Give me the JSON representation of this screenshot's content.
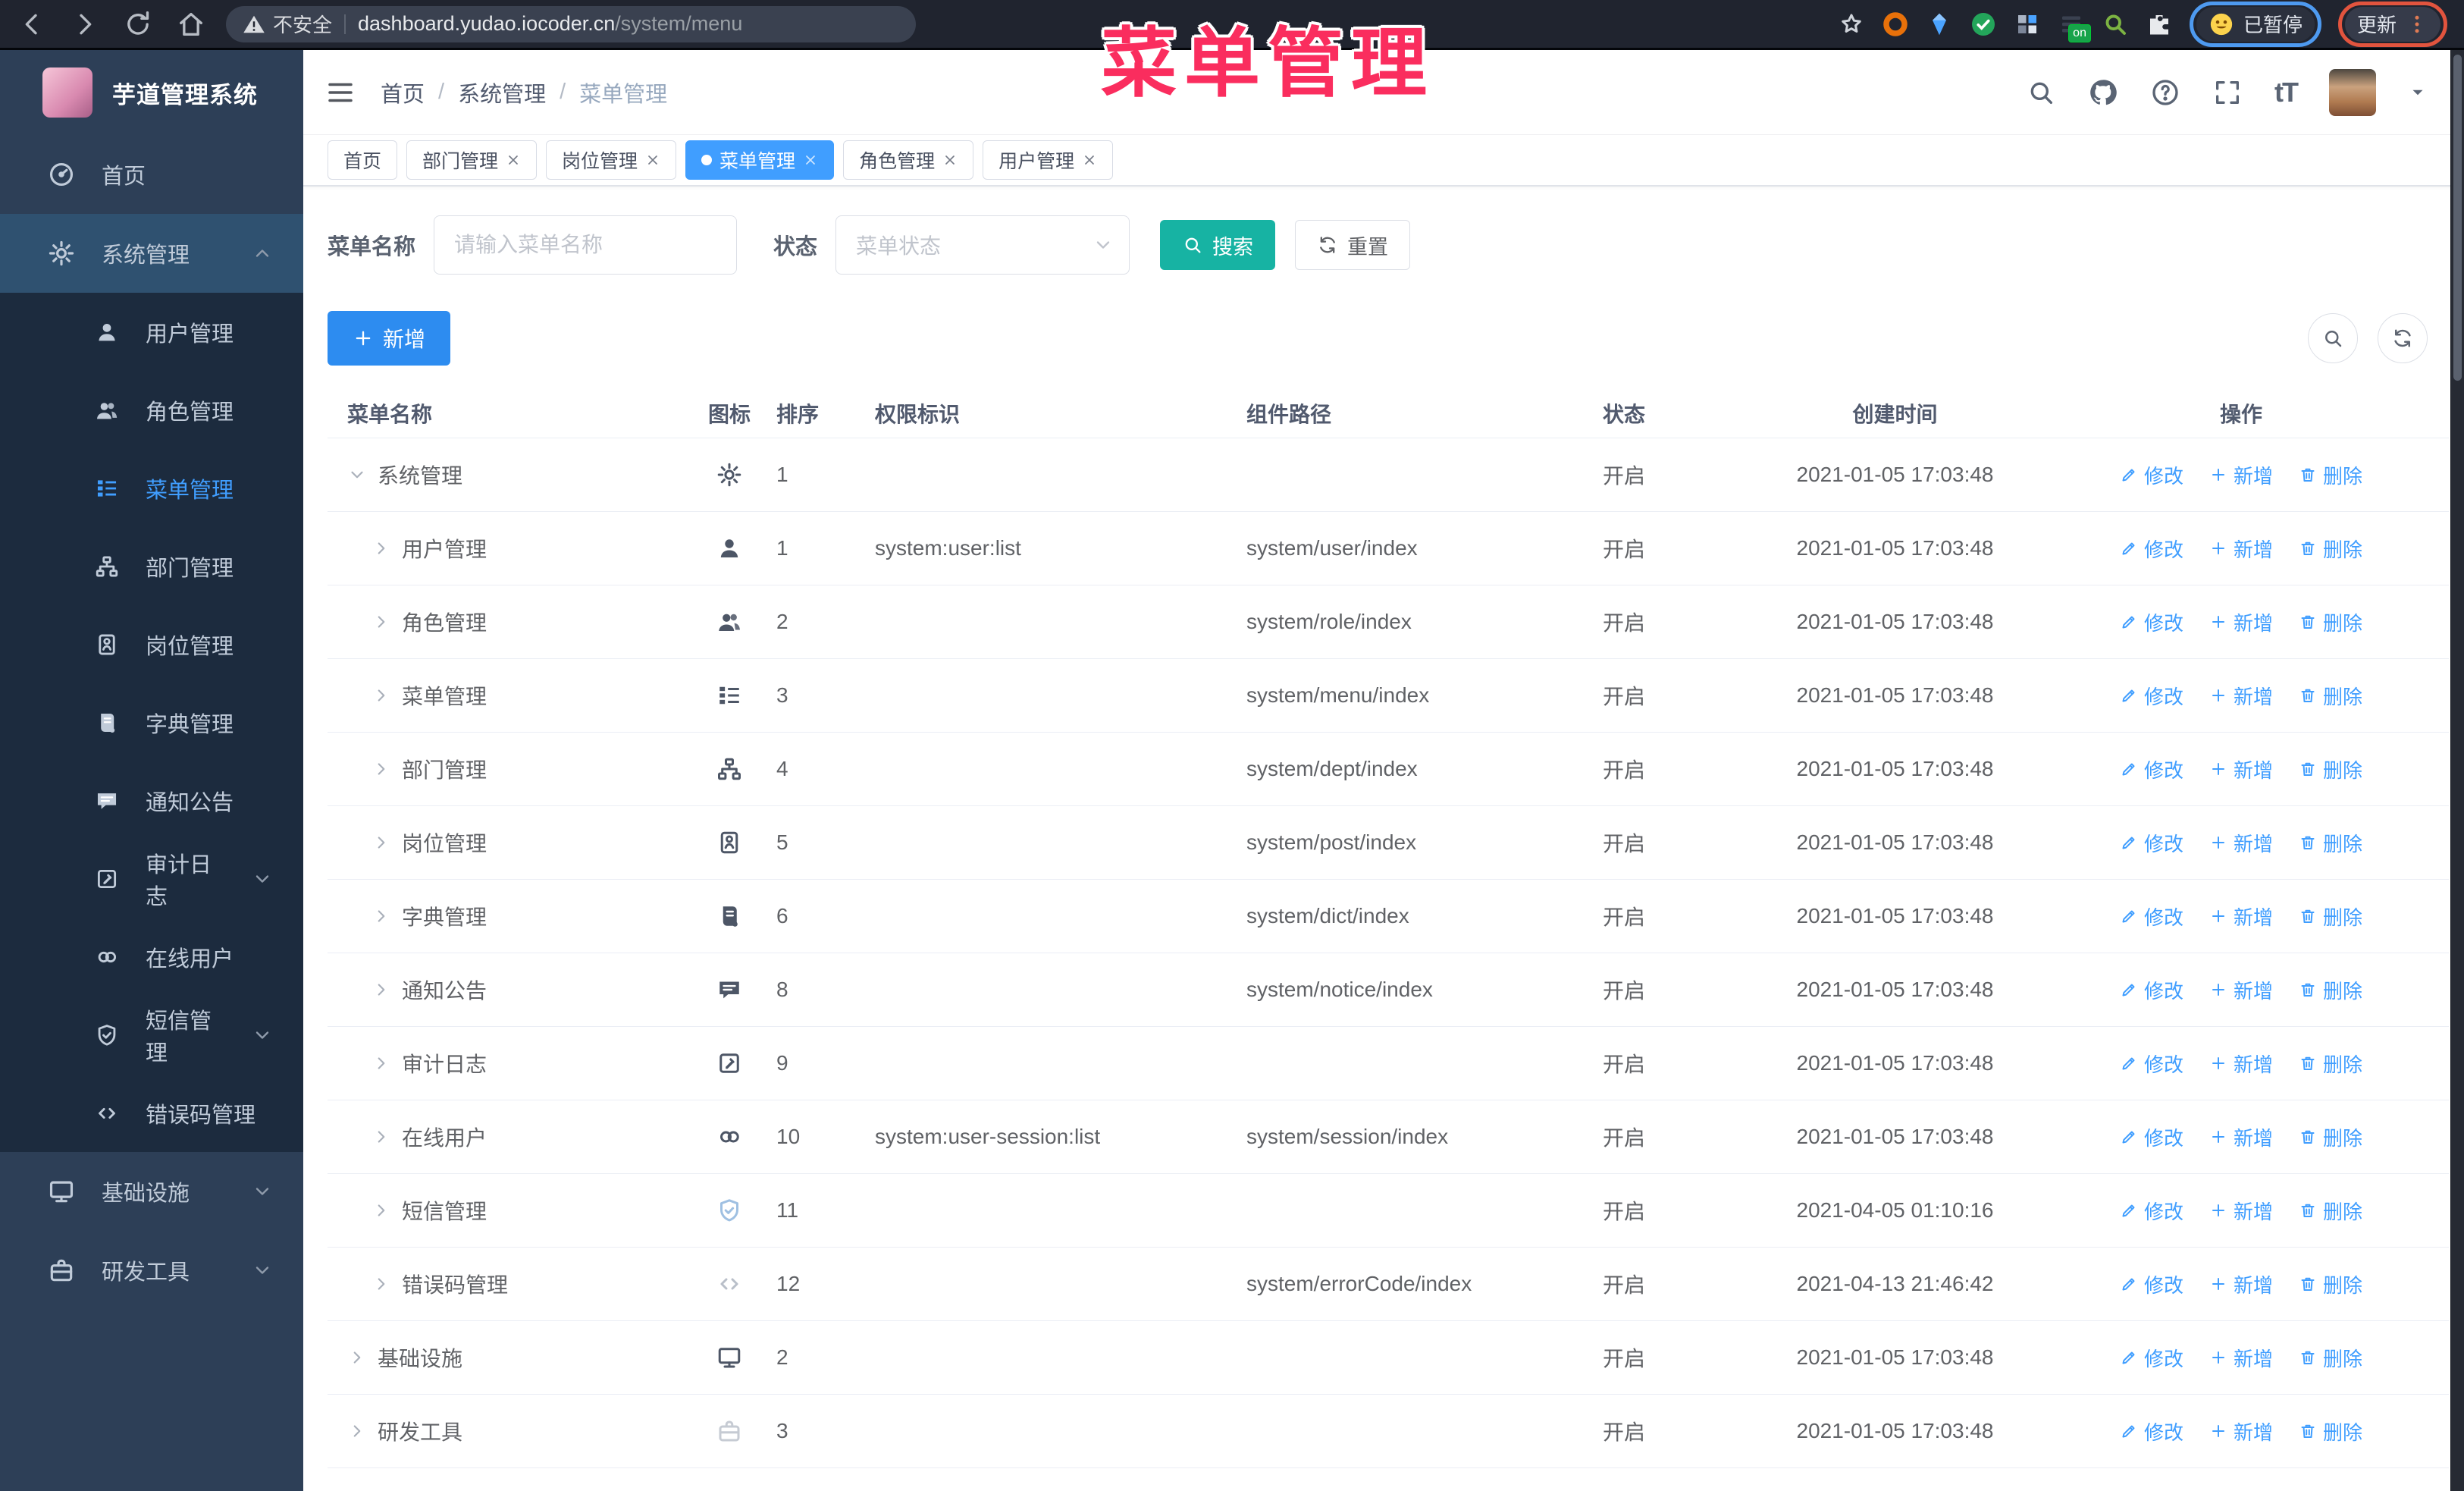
{
  "browser": {
    "nav": [
      "back-icon",
      "forward-icon",
      "reload-icon",
      "home-icon"
    ],
    "security_label": "不安全",
    "url_domain": "dashboard.yudao.iocoder.cn",
    "url_path": "/system/menu",
    "bookmark_icon": "star-icon",
    "extensions": [
      "ext-orange-icon",
      "ext-gem-icon",
      "ext-green-check-icon",
      "ext-grid-icon",
      "ext-on-icon",
      "ext-magnifier-icon",
      "ext-puzzle-icon"
    ],
    "extension_on_badge": "on",
    "paused_badge_label": "已暂停",
    "update_button_label": "更新"
  },
  "annotation": {
    "title": "菜单管理",
    "color": "#fa2d5e"
  },
  "sidebar": {
    "app_title": "芋道管理系统",
    "items": [
      {
        "label": "首页",
        "icon": "home-dash-icon",
        "level": 0
      },
      {
        "label": "系统管理",
        "icon": "gear-icon",
        "level": 0,
        "open": true,
        "chevron": "up"
      },
      {
        "label": "用户管理",
        "icon": "user-icon",
        "level": 1
      },
      {
        "label": "角色管理",
        "icon": "users-icon",
        "level": 1
      },
      {
        "label": "菜单管理",
        "icon": "menu-tree-icon",
        "level": 1,
        "active": true
      },
      {
        "label": "部门管理",
        "icon": "org-icon",
        "level": 1
      },
      {
        "label": "岗位管理",
        "icon": "badge-icon",
        "level": 1
      },
      {
        "label": "字典管理",
        "icon": "book-icon",
        "level": 1
      },
      {
        "label": "通知公告",
        "icon": "message-icon",
        "level": 1
      },
      {
        "label": "审计日志",
        "icon": "log-icon",
        "level": 1,
        "chevron": "down"
      },
      {
        "label": "在线用户",
        "icon": "online-icon",
        "level": 1
      },
      {
        "label": "短信管理",
        "icon": "shield-icon",
        "level": 1,
        "chevron": "down"
      },
      {
        "label": "错误码管理",
        "icon": "code-icon",
        "level": 1
      },
      {
        "label": "基础设施",
        "icon": "monitor-icon",
        "level": 0,
        "chevron": "down"
      },
      {
        "label": "研发工具",
        "icon": "briefcase-icon",
        "level": 0,
        "chevron": "down"
      }
    ]
  },
  "header": {
    "breadcrumb": [
      {
        "label": "首页"
      },
      {
        "label": "系统管理"
      },
      {
        "label": "菜单管理",
        "current": true
      }
    ],
    "icons": [
      "search-icon",
      "github-icon",
      "question-icon",
      "fullscreen-icon",
      "font-size-icon"
    ],
    "font_size_glyph": "tT"
  },
  "tabs": [
    {
      "label": "首页"
    },
    {
      "label": "部门管理",
      "closable": true
    },
    {
      "label": "岗位管理",
      "closable": true
    },
    {
      "label": "菜单管理",
      "closable": true,
      "active": true
    },
    {
      "label": "角色管理",
      "closable": true
    },
    {
      "label": "用户管理",
      "closable": true
    }
  ],
  "search": {
    "name_label": "菜单名称",
    "name_placeholder": "请输入菜单名称",
    "status_label": "状态",
    "status_placeholder": "菜单状态",
    "search_label": "搜索",
    "reset_label": "重置"
  },
  "toolbar": {
    "add_label": "新增"
  },
  "table": {
    "columns": [
      "菜单名称",
      "图标",
      "排序",
      "权限标识",
      "组件路径",
      "状态",
      "创建时间",
      "操作"
    ],
    "actions": {
      "edit": "修改",
      "add": "新增",
      "delete": "删除"
    },
    "rows": [
      {
        "name": "系统管理",
        "icon": "gear-icon",
        "level": 0,
        "caret": "down",
        "sort": "1",
        "perm": "",
        "path": "",
        "status": "开启",
        "time": "2021-01-05 17:03:48"
      },
      {
        "name": "用户管理",
        "icon": "user-icon",
        "level": 1,
        "caret": "right",
        "sort": "1",
        "perm": "system:user:list",
        "path": "system/user/index",
        "status": "开启",
        "time": "2021-01-05 17:03:48"
      },
      {
        "name": "角色管理",
        "icon": "users-icon",
        "level": 1,
        "caret": "right",
        "sort": "2",
        "perm": "",
        "path": "system/role/index",
        "status": "开启",
        "time": "2021-01-05 17:03:48"
      },
      {
        "name": "菜单管理",
        "icon": "menu-tree-icon",
        "level": 1,
        "caret": "right",
        "sort": "3",
        "perm": "",
        "path": "system/menu/index",
        "status": "开启",
        "time": "2021-01-05 17:03:48"
      },
      {
        "name": "部门管理",
        "icon": "org-icon",
        "level": 1,
        "caret": "right",
        "sort": "4",
        "perm": "",
        "path": "system/dept/index",
        "status": "开启",
        "time": "2021-01-05 17:03:48"
      },
      {
        "name": "岗位管理",
        "icon": "badge-icon",
        "level": 1,
        "caret": "right",
        "sort": "5",
        "perm": "",
        "path": "system/post/index",
        "status": "开启",
        "time": "2021-01-05 17:03:48"
      },
      {
        "name": "字典管理",
        "icon": "book-icon",
        "level": 1,
        "caret": "right",
        "sort": "6",
        "perm": "",
        "path": "system/dict/index",
        "status": "开启",
        "time": "2021-01-05 17:03:48"
      },
      {
        "name": "通知公告",
        "icon": "message-icon",
        "level": 1,
        "caret": "right",
        "sort": "8",
        "perm": "",
        "path": "system/notice/index",
        "status": "开启",
        "time": "2021-01-05 17:03:48"
      },
      {
        "name": "审计日志",
        "icon": "log-icon",
        "level": 1,
        "caret": "right",
        "sort": "9",
        "perm": "",
        "path": "",
        "status": "开启",
        "time": "2021-01-05 17:03:48"
      },
      {
        "name": "在线用户",
        "icon": "online-icon",
        "level": 1,
        "caret": "right",
        "sort": "10",
        "perm": "system:user-session:list",
        "path": "system/session/index",
        "status": "开启",
        "time": "2021-01-05 17:03:48"
      },
      {
        "name": "短信管理",
        "icon": "shield-icon",
        "level": 1,
        "caret": "right",
        "sort": "11",
        "perm": "",
        "path": "",
        "status": "开启",
        "time": "2021-04-05 01:10:16",
        "icon_color": "#9fc0e2"
      },
      {
        "name": "错误码管理",
        "icon": "code-icon",
        "level": 1,
        "caret": "right",
        "sort": "12",
        "perm": "",
        "path": "system/errorCode/index",
        "status": "开启",
        "time": "2021-04-13 21:46:42",
        "icon_color": "#b9bfc9"
      },
      {
        "name": "基础设施",
        "icon": "monitor-icon",
        "level": 0,
        "caret": "right",
        "sort": "2",
        "perm": "",
        "path": "",
        "status": "开启",
        "time": "2021-01-05 17:03:48"
      },
      {
        "name": "研发工具",
        "icon": "briefcase-icon",
        "level": 0,
        "caret": "right",
        "sort": "3",
        "perm": "",
        "path": "",
        "status": "开启",
        "time": "2021-01-05 17:03:48",
        "icon_color": "#c6cbd3"
      }
    ]
  }
}
